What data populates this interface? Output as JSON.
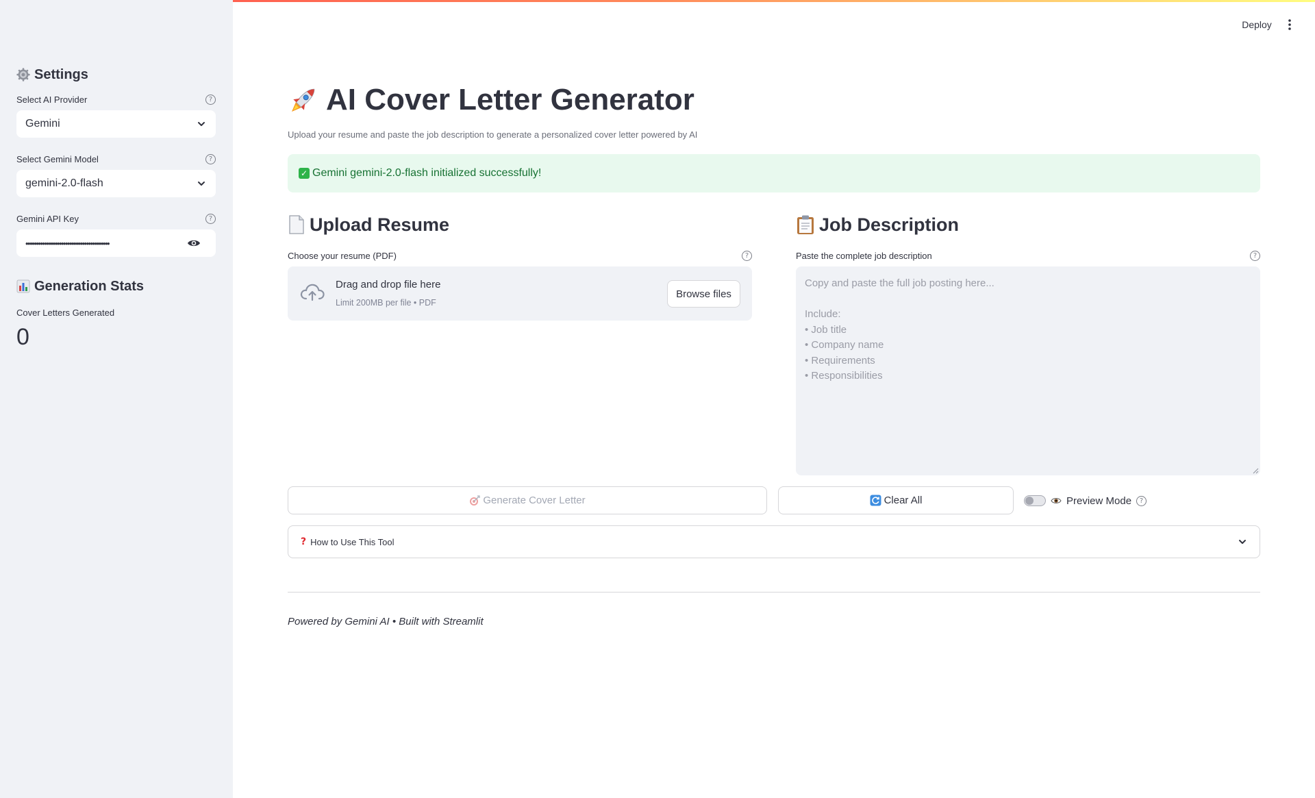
{
  "header": {
    "deploy_label": "Deploy",
    "menu_icon": "vertical-ellipsis-icon"
  },
  "sidebar": {
    "settings_icon": "gear-icon",
    "settings_title": "Settings",
    "provider": {
      "label": "Select AI Provider",
      "value": "Gemini"
    },
    "model": {
      "label": "Select Gemini Model",
      "value": "gemini-2.0-flash"
    },
    "api_key": {
      "label": "Gemini API Key",
      "masked_value": "••••••••••••••••••••••••••••••••••••••••"
    },
    "stats_icon": "bar-chart-icon",
    "stats_title": "Generation Stats",
    "metric": {
      "label": "Cover Letters Generated",
      "value": "0"
    }
  },
  "main": {
    "title_icon": "rocket-icon",
    "title": "AI Cover Letter Generator",
    "subtitle": "Upload your resume and paste the job description to generate a personalized cover letter powered by AI",
    "alert_text": "Gemini gemini-2.0-flash initialized successfully!",
    "alert_color": "#177233",
    "upload": {
      "icon": "document-icon",
      "heading": "Upload Resume",
      "label": "Choose your resume (PDF)",
      "drop_text": "Drag and drop file here",
      "limit_text": "Limit 200MB per file • PDF",
      "browse_label": "Browse files"
    },
    "job": {
      "icon": "clipboard-icon",
      "heading": "Job Description",
      "label": "Paste the complete job description",
      "placeholder_lines": [
        "Copy and paste the full job posting here...",
        "",
        "Include:",
        "• Job title",
        "• Company name",
        "• Requirements",
        "• Responsibilities"
      ]
    },
    "actions": {
      "generate_label": "Generate Cover Letter",
      "generate_icon": "target-icon",
      "clear_label": "Clear All",
      "clear_icon": "refresh-icon",
      "preview_label": "Preview Mode",
      "preview_icon": "eye-icon",
      "preview_enabled": false
    },
    "help_expander": {
      "label": "How to Use This Tool",
      "icon": "question-mark-icon"
    },
    "footer": "Powered by Gemini AI • Built with Streamlit"
  }
}
